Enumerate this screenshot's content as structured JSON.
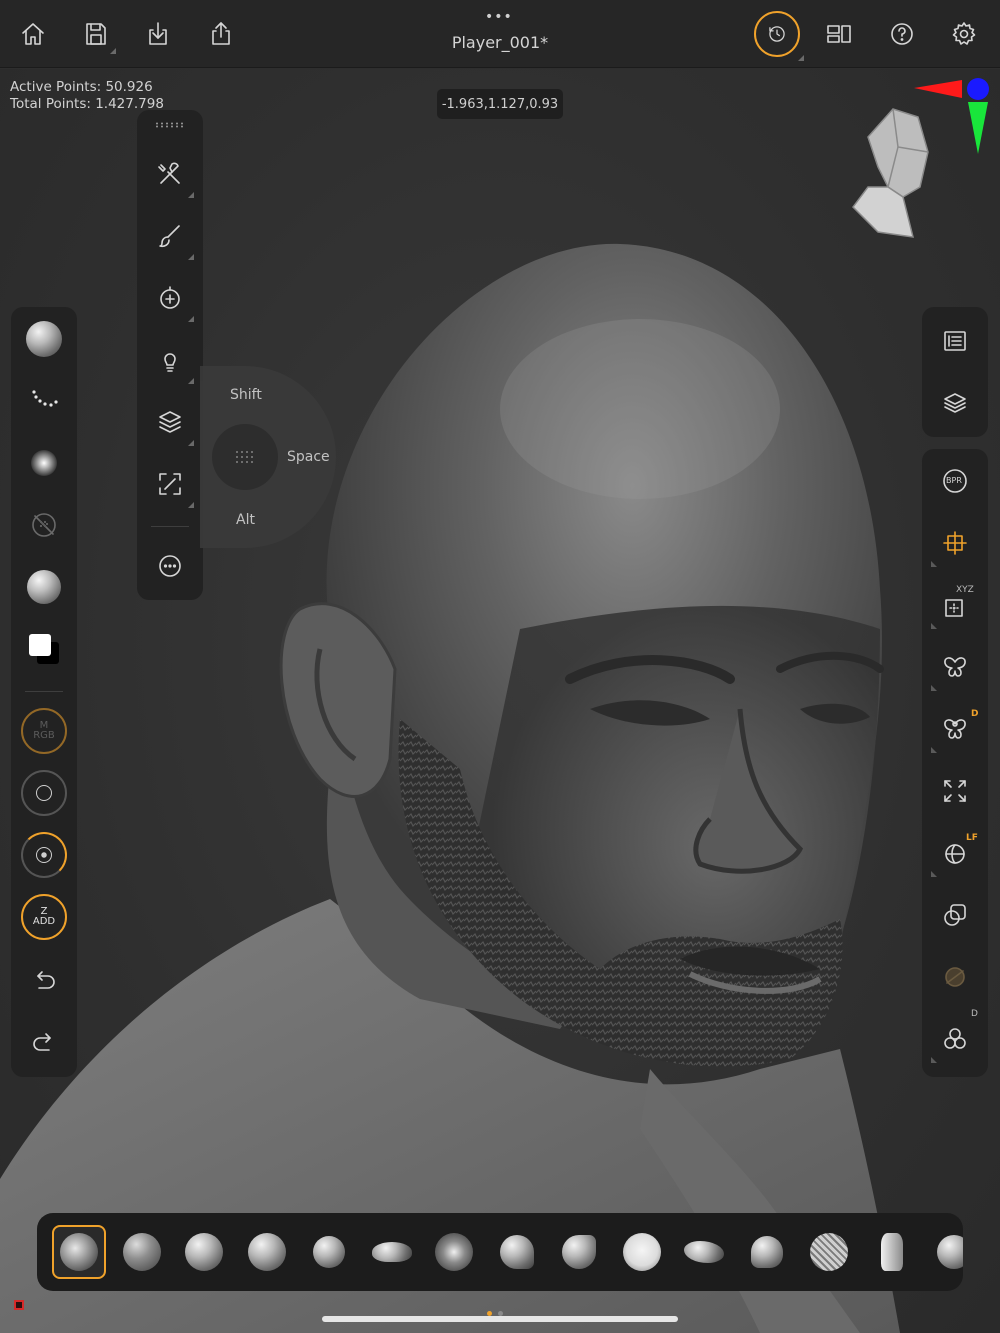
{
  "header": {
    "title": "Player_001*",
    "more_glyph": "•••"
  },
  "toolbar_left": [
    {
      "name": "home",
      "icon": "home-icon"
    },
    {
      "name": "save",
      "icon": "save-icon"
    },
    {
      "name": "import",
      "icon": "import-icon"
    },
    {
      "name": "export",
      "icon": "share-icon"
    }
  ],
  "toolbar_right": [
    {
      "name": "history",
      "icon": "history-icon",
      "active": true
    },
    {
      "name": "layout",
      "icon": "layout-icon"
    },
    {
      "name": "help",
      "icon": "help-icon"
    },
    {
      "name": "settings",
      "icon": "gear-icon"
    }
  ],
  "stats": {
    "active_points": "Active Points: 50.926",
    "total_points": "Total Points: 1.427.798"
  },
  "cursor_coordinates": "-1.963,1.127,0.93",
  "modifier_pad": {
    "shift": "Shift",
    "space": "Space",
    "alt": "Alt"
  },
  "left_column": {
    "zadd_top": "Z",
    "zadd_bottom": "ADD",
    "color_primary": "#ffffff",
    "color_secondary": "#000000"
  },
  "right_column": {
    "bpr": "BPR",
    "xyz": "XYZ",
    "d_badge": "D",
    "lf_badge": "LF",
    "d_badge_2": "D"
  },
  "accent_color": "#f0a22b",
  "brushes": [
    "clay-buildup",
    "dam-standard",
    "move",
    "standard",
    "inflate",
    "snake-hook",
    "clay-tubes",
    "trim-dynamic",
    "h-polish",
    "smooth",
    "chisel-creature",
    "pinch",
    "curve-surface",
    "imm-mannequin",
    "groom"
  ],
  "pagination": {
    "pages": 2,
    "current": 1
  }
}
